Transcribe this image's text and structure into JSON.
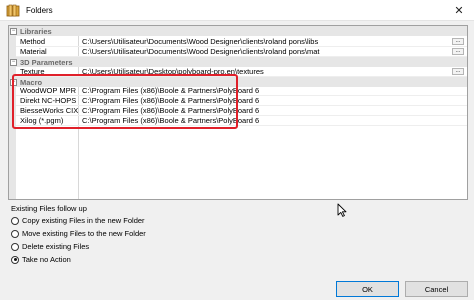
{
  "window": {
    "title": "Folders",
    "close_glyph": "✕",
    "icon": "folder-icon"
  },
  "grid": {
    "categories": [
      {
        "name": "Libraries",
        "rows": [
          {
            "name": "Method",
            "value": "C:\\Users\\Utilisateur\\Documents\\Wood Designer\\clients\\roland pons\\libs"
          },
          {
            "name": "Material",
            "value": "C:\\Users\\Utilisateur\\Documents\\Wood Designer\\clients\\roland pons\\mat"
          }
        ]
      },
      {
        "name": "3D Parameters",
        "rows": [
          {
            "name": "Texture",
            "value": "C:\\Users\\Utilisateur\\Desktop\\polyboard-pro.en\\textures"
          }
        ]
      },
      {
        "name": "Macro",
        "rows": [
          {
            "name": "WoodWOP MPR",
            "value": "C:\\Program Files (x86)\\Boole & Partners\\PolyBoard 6"
          },
          {
            "name": "Direkt NC-HOPS",
            "value": "C:\\Program Files (x86)\\Boole & Partners\\PolyBoard 6"
          },
          {
            "name": "BiesseWorks CIX",
            "value": "C:\\Program Files (x86)\\Boole & Partners\\PolyBoard 6"
          },
          {
            "name": "Xilog (*.pgm)",
            "value": "C:\\Program Files (x86)\\Boole & Partners\\PolyBoard 6"
          }
        ]
      }
    ],
    "collapse_glyph": "−",
    "ellipsis": "..."
  },
  "existing_files": {
    "title": "Existing Files follow up",
    "options": [
      {
        "label": "Copy existing Files in the new Folder",
        "selected": false
      },
      {
        "label": "Move existing Files to the new Folder",
        "selected": false
      },
      {
        "label": "Delete existing Files",
        "selected": false
      },
      {
        "label": "Take no Action",
        "selected": true
      }
    ]
  },
  "buttons": {
    "ok": "OK",
    "cancel": "Cancel"
  },
  "colors": {
    "highlight": "#e0202a",
    "category_bg": "#e6e6e6",
    "default_button_border": "#0078d7"
  }
}
